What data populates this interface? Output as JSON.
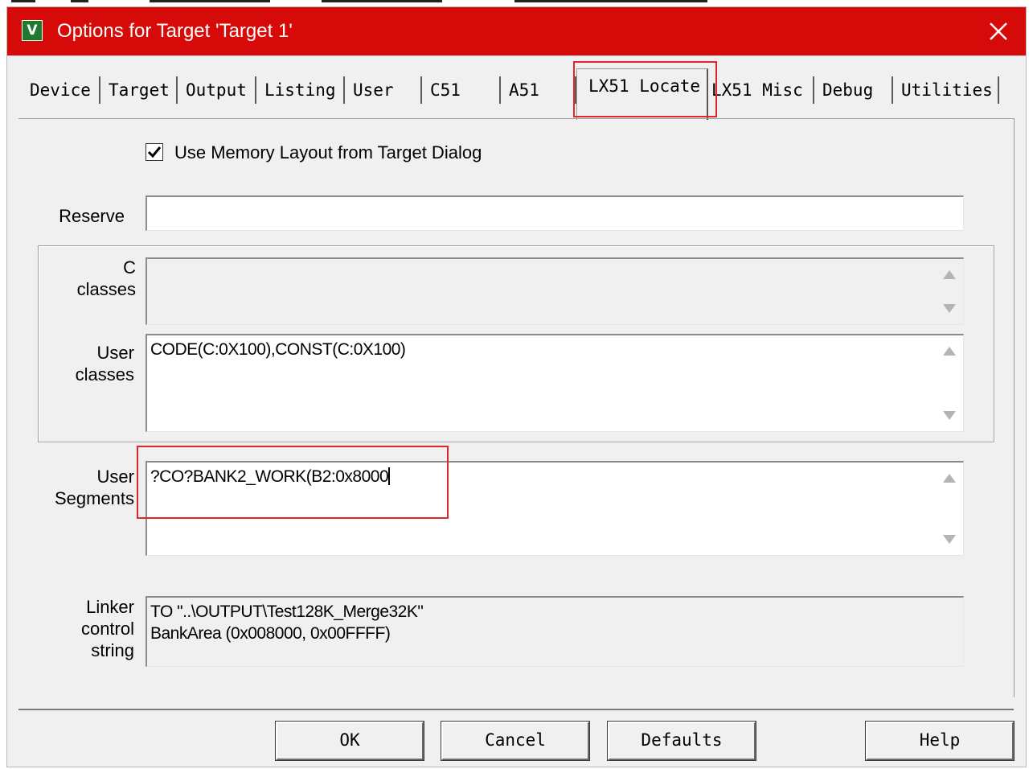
{
  "window": {
    "title": "Options for Target 'Target 1'",
    "icon": "keil-uvision-icon",
    "title_bar_color": "#d70a0a"
  },
  "tabs": [
    {
      "label": "Device"
    },
    {
      "label": "Target"
    },
    {
      "label": "Output"
    },
    {
      "label": "Listing"
    },
    {
      "label": "User"
    },
    {
      "label": "C51"
    },
    {
      "label": "A51"
    },
    {
      "label": "LX51 Locate",
      "active": true
    },
    {
      "label": "LX51 Misc"
    },
    {
      "label": "Debug"
    },
    {
      "label": "Utilities"
    }
  ],
  "locate": {
    "use_memory_layout": {
      "checked": true,
      "label": "Use Memory Layout from Target Dialog"
    },
    "reserve": {
      "label": "Reserve",
      "value": ""
    },
    "c_classes": {
      "label_line1": "C",
      "label_line2": "classes",
      "value": ""
    },
    "user_classes": {
      "label_line1": "User",
      "label_line2": "classes",
      "value": "CODE(C:0X100),CONST(C:0X100)"
    },
    "user_segments": {
      "label_line1": "User",
      "label_line2": "Segments",
      "value": "?CO?BANK2_WORK(B2:0x8000"
    },
    "linker_control": {
      "label_line1": "Linker",
      "label_line2": "control",
      "label_line3": "string",
      "line1": "TO \"..\\OUTPUT\\Test128K_Merge32K\"",
      "line2": "BankArea (0x008000, 0x00FFFF)"
    }
  },
  "buttons": {
    "ok": "OK",
    "cancel": "Cancel",
    "defaults": "Defaults",
    "help": "Help"
  },
  "annotation_color": "#e0262a"
}
